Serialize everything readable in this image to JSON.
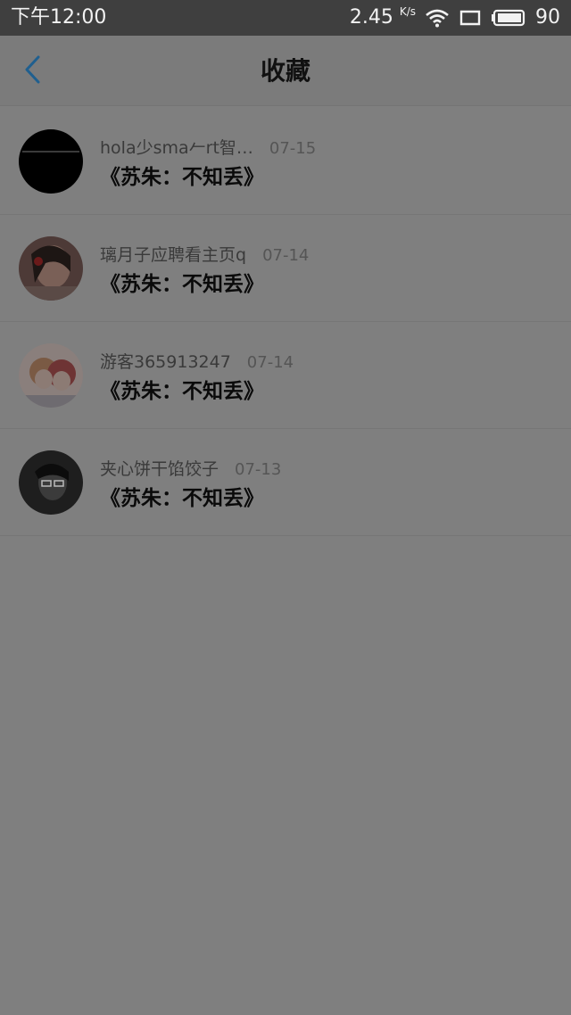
{
  "status_bar": {
    "time": "下午12:00",
    "net_speed": "2.45",
    "net_unit": "K/s",
    "battery": "90",
    "icons": [
      "wifi-icon",
      "screen-icon",
      "battery-icon"
    ]
  },
  "header": {
    "title": "收藏",
    "back_icon": "chevron-left-icon",
    "accent_color": "#1f5f8f"
  },
  "favorites": [
    {
      "user": "hola少sma𠂉rt智…",
      "date": "07-15",
      "book": "《苏朱：不知丢》",
      "avatar": "black-avatar"
    },
    {
      "user": "璃月子应聘看主页q",
      "date": "07-14",
      "book": "《苏朱：不知丢》",
      "avatar": "girl-photo-avatar"
    },
    {
      "user": "游客365913247",
      "date": "07-14",
      "book": "《苏朱：不知丢》",
      "avatar": "anime-avatar"
    },
    {
      "user": "夹心饼干馅饺子",
      "date": "07-13",
      "book": "《苏朱：不知丢》",
      "avatar": "dark-photo-avatar"
    }
  ]
}
